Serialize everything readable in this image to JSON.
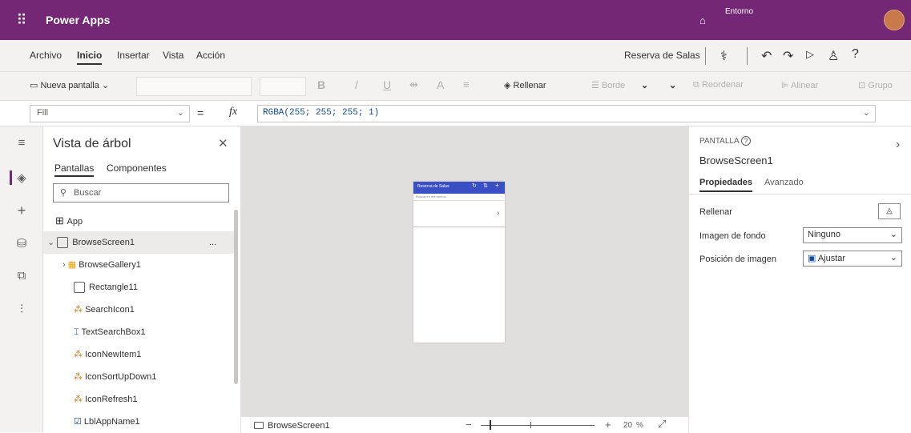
{
  "titlebar": {
    "app_name": "Power Apps",
    "env_label": "Entorno"
  },
  "menu": {
    "items": [
      "Archivo",
      "Inicio",
      "Insertar",
      "Vista",
      "Acción"
    ],
    "app_label": "Reserva de Salas"
  },
  "toolbar": {
    "new_screen": "Nueva pantalla",
    "bold": "B",
    "italic": "/",
    "underline": "U",
    "font_color": "A",
    "fill": "Rellenar",
    "border": "Borde",
    "reorder": "Reordenar",
    "align": "Alinear",
    "group": "Grupo"
  },
  "formula": {
    "property": "Fill",
    "equals": "=",
    "fx": "fx",
    "value": "RGBA(255; 255; 255; 1)"
  },
  "tree": {
    "title": "Vista de árbol",
    "tab_screens": "Pantallas",
    "tab_components": "Componentes",
    "search_placeholder": "Buscar",
    "app": "App",
    "screen": "BrowseScreen1",
    "more": "...",
    "items": [
      "BrowseGallery1",
      "Rectangle11",
      "SearchIcon1",
      "TextSearchBox1",
      "IconNewItem1",
      "IconSortUpDown1",
      "IconRefresh1",
      "LblAppName1"
    ]
  },
  "phone": {
    "title": "Reserva de Salas",
    "search": "Buscar en elementos"
  },
  "status": {
    "screen": "BrowseScreen1",
    "zoom": "20",
    "percent": "%"
  },
  "props": {
    "type": "PANTALLA",
    "name": "BrowseScreen1",
    "tab_props": "Propiedades",
    "tab_adv": "Avanzado",
    "fill_label": "Rellenar",
    "bg_label": "Imagen de fondo",
    "bg_value": "Ninguno",
    "pos_label": "Posición de imagen",
    "pos_value": "Ajustar"
  }
}
